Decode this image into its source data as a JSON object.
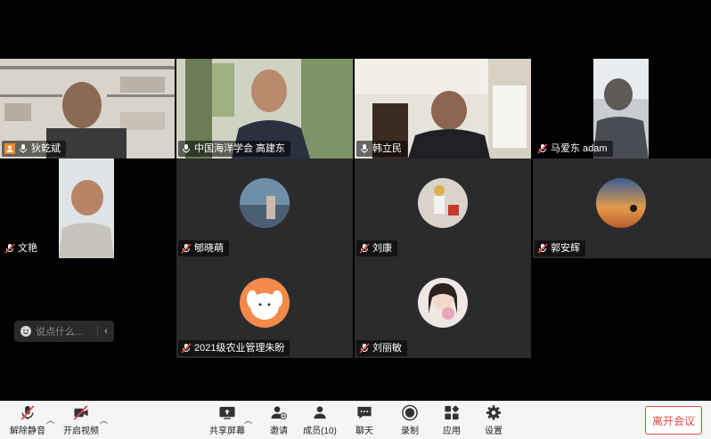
{
  "participants_video": [
    {
      "name": "狄乾斌"
    },
    {
      "name": "中国海洋学会 高建东"
    },
    {
      "name": "韩立民"
    },
    {
      "name": "马爱东 adam"
    },
    {
      "name": "文艳"
    }
  ],
  "participants_avatar": [
    {
      "name": "郇晓萌"
    },
    {
      "name": "刘康"
    },
    {
      "name": "郭安辉"
    },
    {
      "name": "2021级农业管理朱盼"
    },
    {
      "name": "刘丽敏"
    }
  ],
  "chat": {
    "placeholder": "说点什么..."
  },
  "toolbar": {
    "unmute": "解除静音",
    "start_video": "开启视频",
    "share_screen": "共享屏幕",
    "invite": "邀请",
    "members": "成员(10)",
    "chat": "聊天",
    "record": "录制",
    "apps": "应用",
    "settings": "设置",
    "leave": "离开会议"
  },
  "colors": {
    "active_speaker": "#2dbf60",
    "leave": "#e24a3b",
    "muted_icon": "#e24a3b"
  }
}
